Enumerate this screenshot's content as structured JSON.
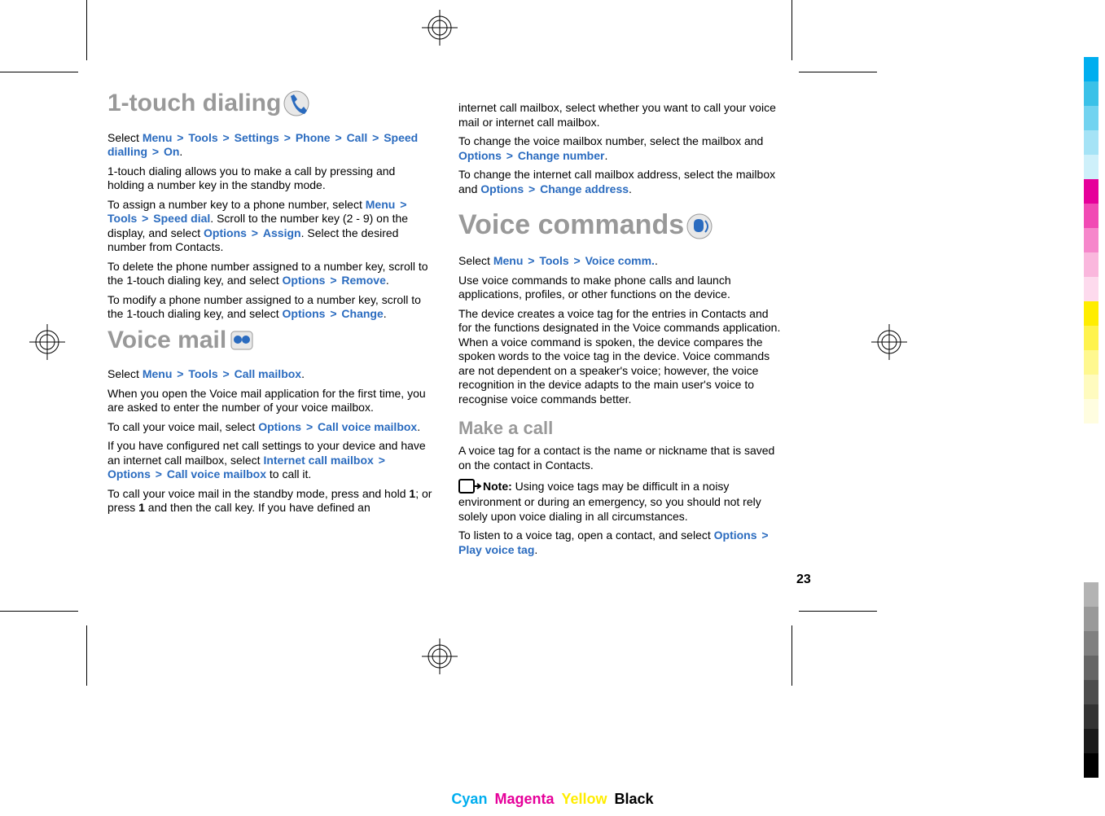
{
  "page_number": "23",
  "col1": {
    "h1": "1-touch dialing",
    "p1_pre": "Select ",
    "p1_links": [
      "Menu",
      "Tools",
      "Settings",
      "Phone",
      "Call",
      "Speed dialling",
      "On"
    ],
    "p1_post": ".",
    "p2": "1-touch dialing allows you to make a call by pressing and holding a number key in the standby mode.",
    "p3_pre": "To assign a number key to a phone number, select ",
    "p3_links1": [
      "Menu",
      "Tools",
      "Speed dial"
    ],
    "p3_mid": ". Scroll to the number key (2 - 9) on the display, and select ",
    "p3_links2": [
      "Options",
      "Assign"
    ],
    "p3_post": ". Select the desired number from Contacts.",
    "p4_pre": "To delete the phone number assigned to a number key, scroll to the 1-touch dialing key, and select ",
    "p4_links": [
      "Options",
      "Remove"
    ],
    "p4_post": ".",
    "p5_pre": "To modify a phone number assigned to a number key, scroll to the 1-touch dialing key, and select ",
    "p5_links": [
      "Options",
      "Change"
    ],
    "p5_post": ".",
    "h2": "Voice mail",
    "p6_pre": "Select ",
    "p6_links": [
      "Menu",
      "Tools",
      "Call mailbox"
    ],
    "p6_post": ".",
    "p7": "When you open the Voice mail application for the first time, you are asked to enter the number of your voice mailbox.",
    "p8_pre": "To call your voice mail, select ",
    "p8_links": [
      "Options",
      "Call voice mailbox"
    ],
    "p8_post": ".",
    "p9_pre": "If you have configured net call settings to your device and have an internet call mailbox, select ",
    "p9_links": [
      "Internet call mailbox",
      "Options",
      "Call voice mailbox"
    ],
    "p9_post": " to call it.",
    "p10_pre": "To call your voice mail in the standby mode, press and hold ",
    "p10_bold1": "1",
    "p10_mid": "; or press ",
    "p10_bold2": "1",
    "p10_post": " and then the call key. If you have defined an "
  },
  "col2": {
    "p1": "internet call mailbox, select whether you want to call your voice mail or internet call mailbox.",
    "p2_pre": "To change the voice mailbox number, select the mailbox and ",
    "p2_links": [
      "Options",
      "Change number"
    ],
    "p2_post": ".",
    "p3_pre": "To change the internet call mailbox address, select the mailbox and ",
    "p3_links": [
      "Options",
      "Change address"
    ],
    "p3_post": ".",
    "h1": "Voice commands",
    "p4_pre": "Select ",
    "p4_links": [
      "Menu",
      "Tools",
      "Voice comm."
    ],
    "p4_post": ".",
    "p5": "Use voice commands to make phone calls and launch applications, profiles, or other functions on the device.",
    "p6": "The device creates a voice tag for the entries in Contacts and for the functions designated in the Voice commands application. When a voice command is spoken, the device compares the spoken words to the voice tag in the device. Voice commands are not dependent on a speaker's voice; however, the voice recognition in the device adapts to the main user's voice to recognise voice commands better.",
    "h2": "Make a call",
    "p7": "A voice tag for a contact is the name or nickname that is saved on the contact in Contacts.",
    "note_label": "Note:  ",
    "note_text": "Using voice tags may be difficult in a noisy environment or during an emergency, so you should not rely solely upon voice dialing in all circumstances.",
    "p8_pre": "To listen to a voice tag, open a contact, and select ",
    "p8_links": [
      "Options",
      "Play voice tag"
    ],
    "p8_post": "."
  },
  "footer": {
    "cyan": "Cyan",
    "magenta": "Magenta",
    "yellow": "Yellow",
    "black": "Black"
  },
  "colors": {
    "strip": [
      "#00aeef",
      "#3ac1e8",
      "#72d3f0",
      "#a5e3f6",
      "#cef0fa",
      "#e6009a",
      "#f14ab4",
      "#f687cb",
      "#fab7dd",
      "#fddaed",
      "#ffed00",
      "#fff34d",
      "#fff88f",
      "#fffbbf",
      "#fffde0"
    ],
    "gray": [
      "#b3b3b3",
      "#999999",
      "#808080",
      "#666666",
      "#4d4d4d",
      "#333333",
      "#1a1a1a",
      "#000000"
    ]
  }
}
